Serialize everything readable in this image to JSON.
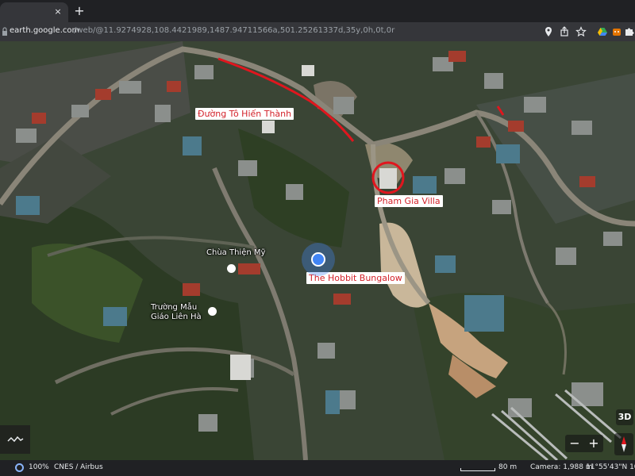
{
  "browser": {
    "tab_close": "×",
    "new_tab": "+",
    "url_host": "earth.google.com",
    "url_path": "/web/@11.9274928,108.4421989,1487.94711566a,501.25261337d,35y,0h,0t,0r"
  },
  "map": {
    "labels": {
      "street": "Đường Tô Hiến Thành",
      "villa": "Pham Gia Villa",
      "bungalow": "The Hobbit Bungalow",
      "pagoda": "Chùa Thiện Mỹ",
      "school_line1": "Trường Mẫu",
      "school_line2": "Giáo Liên Hà"
    },
    "controls": {
      "three_d": "3D",
      "zoom_out": "−",
      "zoom_in": "+"
    },
    "colors": {
      "annotation_red": "#e0161e",
      "location_blue": "#4285f4"
    }
  },
  "status": {
    "zoom_percent": "100%",
    "attribution": "CNES / Airbus",
    "scale": "80 m",
    "camera": "Camera: 1,988 m",
    "coordinates": "11°55'43\"N 108°"
  }
}
